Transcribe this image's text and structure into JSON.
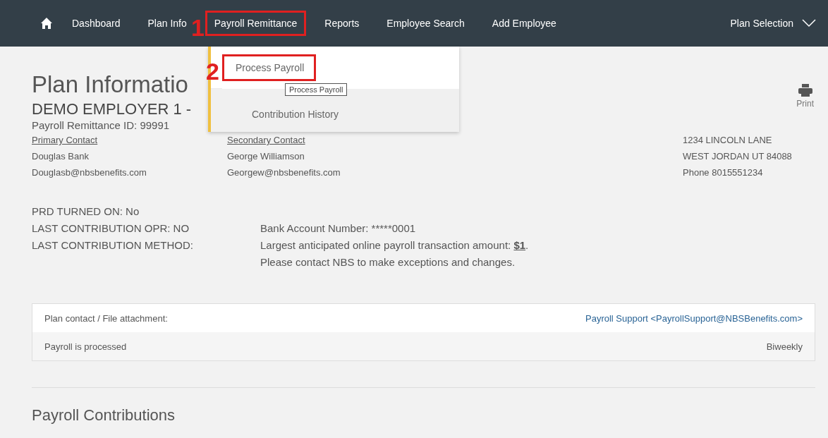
{
  "nav": {
    "items": [
      {
        "label": "Dashboard",
        "highlighted": false
      },
      {
        "label": "Plan Info",
        "highlighted": false
      },
      {
        "label": "Payroll Remittance",
        "highlighted": true
      },
      {
        "label": "Reports",
        "highlighted": false
      },
      {
        "label": "Employee Search",
        "highlighted": false
      },
      {
        "label": "Add Employee",
        "highlighted": false
      }
    ],
    "plan_selection": "Plan Selection"
  },
  "dropdown": {
    "items": [
      {
        "label": "Process Payroll",
        "hovered": true,
        "highlighted": true
      },
      {
        "label": "Contribution History",
        "hovered": false,
        "highlighted": false
      }
    ],
    "tooltip": "Process Payroll"
  },
  "annotations": [
    "1",
    "2"
  ],
  "header": {
    "title": "Plan Informatio",
    "employer": "DEMO EMPLOYER 1 -",
    "remittance_id": "Payroll Remittance ID: 99991",
    "print": "Print"
  },
  "contacts": [
    {
      "heading": "Primary Contact",
      "name": "Douglas Bank",
      "email": "Douglasb@nbsbenefits.com"
    },
    {
      "heading": "Secondary Contact",
      "name": "George Williamson",
      "email": "Georgew@nbsbenefits.com"
    }
  ],
  "address": [
    "1234 LINCOLN LANE",
    "WEST JORDAN UT 84088",
    "Phone 8015551234"
  ],
  "status": {
    "lines": [
      "PRD TURNED ON: No",
      "LAST CONTRIBUTION OPR: NO",
      "LAST CONTRIBUTION METHOD:"
    ],
    "bank_account": "Bank Account Number: *****0001",
    "limit": "Largest anticipated online payroll transaction amount: **$1**.",
    "note": "Please contact NBS to make exceptions and changes."
  },
  "details": [
    {
      "label": "Plan contact / File attachment:",
      "value": "Payroll Support <PayrollSupport@NBSBenefits.com>",
      "kind": "link"
    },
    {
      "label": "Payroll is processed",
      "value": "Biweekly",
      "kind": "text"
    }
  ],
  "section_title": "Payroll Contributions"
}
